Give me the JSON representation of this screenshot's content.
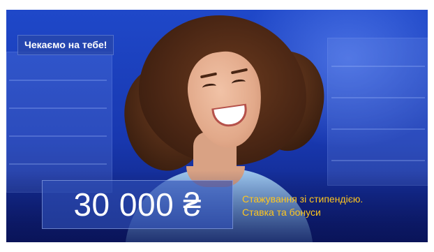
{
  "banner": {
    "tag_text": "Чекаємо на тебе!",
    "salary": "30 000 ₴",
    "perks": {
      "line1": "Стажування зі стипендією.",
      "line2": "Ставка та бонуси"
    }
  },
  "colors": {
    "background_blue": "#1f48c9",
    "accent_yellow": "#ffc61e",
    "text_white": "#ffffff"
  },
  "image": {
    "subject": "smiling-woman-photo",
    "icon": "person-photo-icon"
  }
}
